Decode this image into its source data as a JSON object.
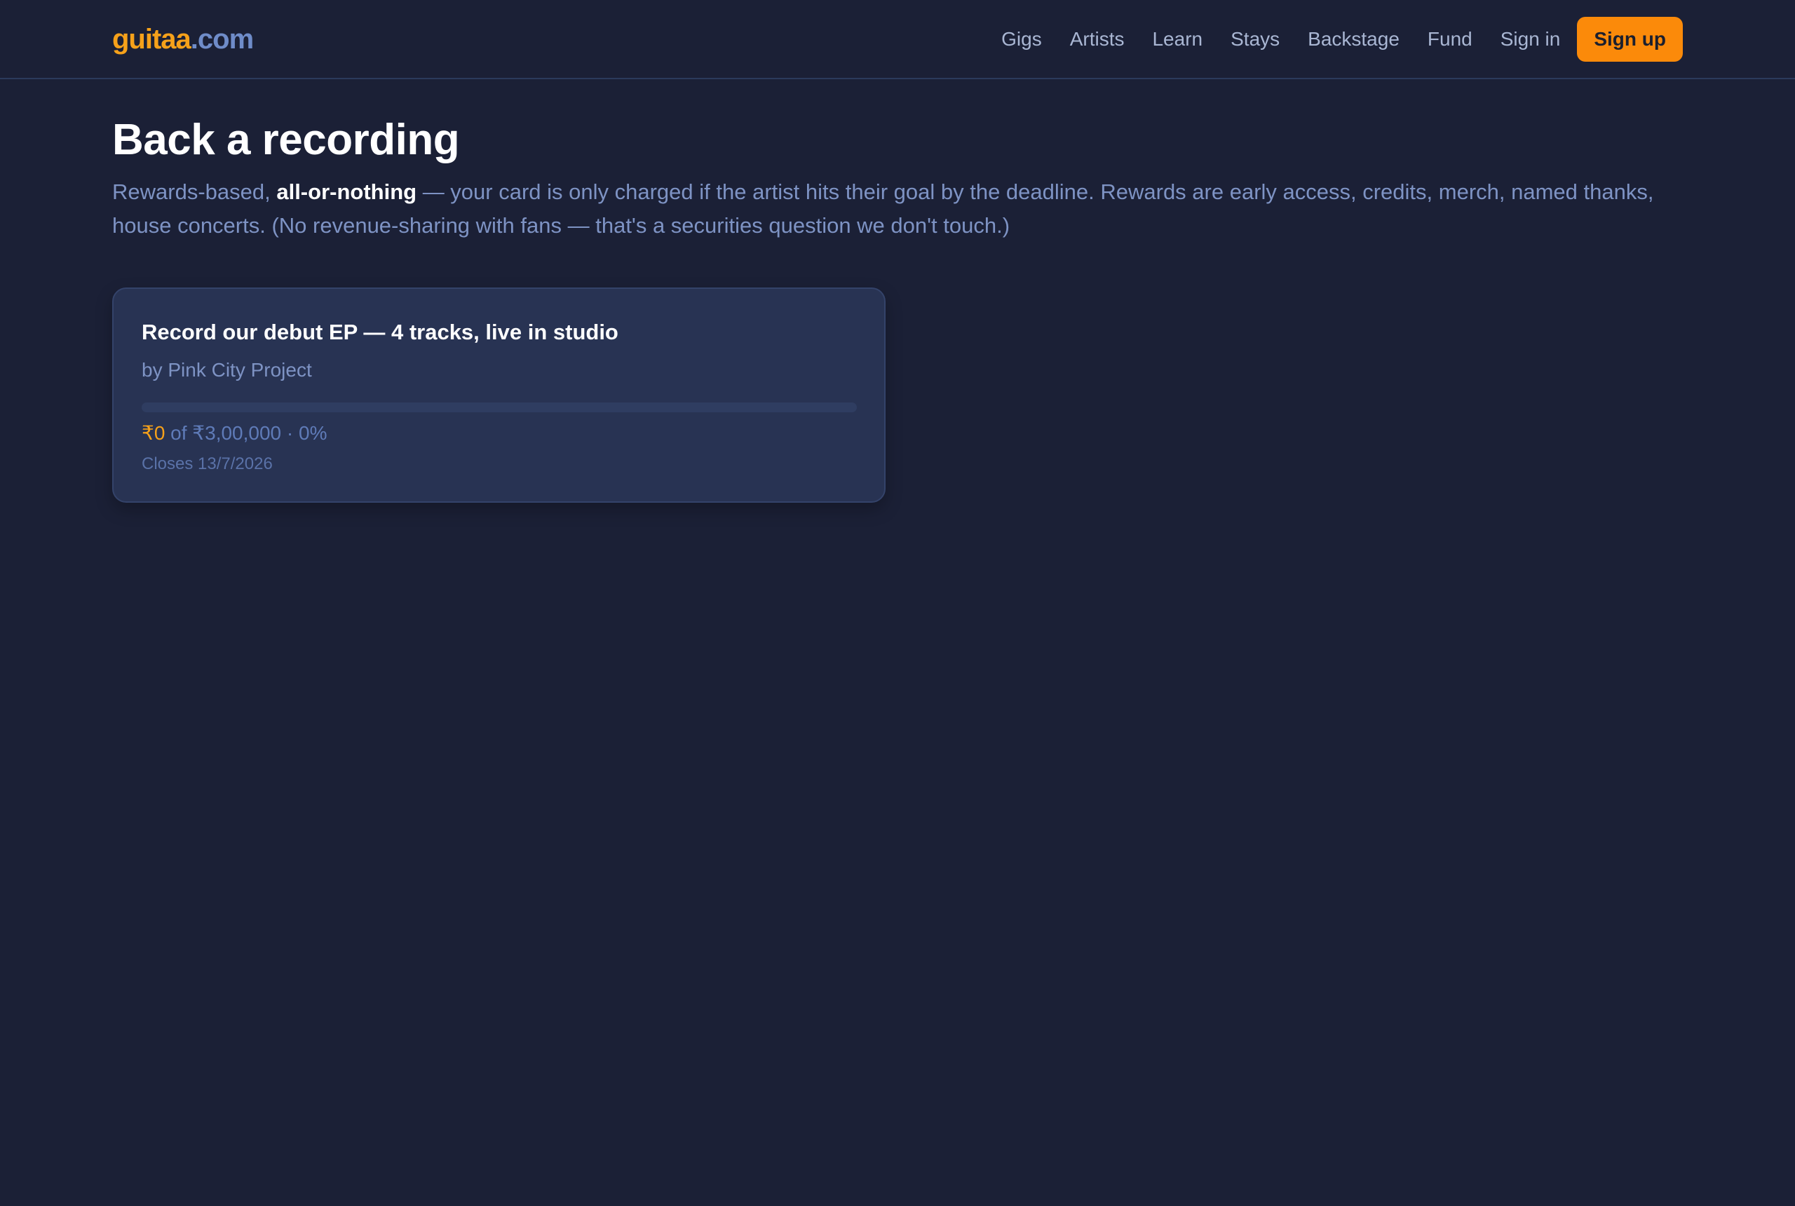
{
  "header": {
    "logo_brand": "guitaa",
    "logo_tld": ".com",
    "nav": [
      "Gigs",
      "Artists",
      "Learn",
      "Stays",
      "Backstage",
      "Fund",
      "Sign in"
    ],
    "signup_label": "Sign up"
  },
  "page": {
    "title": "Back a recording",
    "intro_prefix": "Rewards-based, ",
    "intro_bold": "all-or-nothing",
    "intro_suffix": " — your card is only charged if the artist hits their goal by the deadline. Rewards are early access, credits, merch, named thanks, house concerts. (No revenue-sharing with fans — that's a securities question we don't touch.)"
  },
  "campaigns": [
    {
      "title": "Record our debut EP — 4 tracks, live in studio",
      "artist": "by Pink City Project",
      "raised": "₹0",
      "goal_text": " of ₹3,00,000 · 0%",
      "progress_fraction": 0,
      "closes": "Closes 13/7/2026"
    }
  ],
  "colors": {
    "background": "#1b2036",
    "accent": "#f6a11a",
    "signup_button": "#fb8a0a",
    "card": "#283353",
    "muted_text": "#7e93c4"
  }
}
